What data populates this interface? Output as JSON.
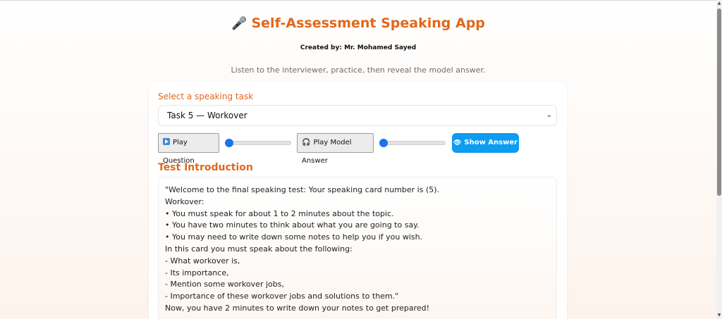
{
  "header": {
    "icon": "microphone-icon",
    "title": "Self-Assessment Speaking App",
    "author": "Created by: Mr. Mohamed Sayed",
    "subtitle": "Listen to the interviewer, practice, then reveal the model answer."
  },
  "task_selector": {
    "label": "Select a speaking task",
    "selected": "Task 5 — Workover"
  },
  "controls": {
    "play_question_label": "Play Question",
    "question_volume": 0,
    "play_model_label": "Play Model Answer",
    "model_volume": 0,
    "show_answer_label": "Show Answer"
  },
  "intro": {
    "heading": "Test Introduction",
    "lines": [
      "\"Welcome to the final speaking test: Your speaking card number is (5).",
      "Workover:",
      "• You must speak for about 1 to 2 minutes about the topic.",
      "• You have two minutes to think about what you are going to say.",
      "• You may need to write down some notes to help you if you wish.",
      "In this card you must speak about the following:",
      "- What workover is,",
      "- Its importance,",
      "- Mention some workover jobs,",
      "- Importance of these workover jobs and solutions to them.\"",
      "Now, you have 2 minutes to write down your notes to get prepared!"
    ]
  },
  "colors": {
    "accent": "#e0681a",
    "button_blue": "#0d9cf0",
    "slider_blue": "#1a73e8"
  }
}
